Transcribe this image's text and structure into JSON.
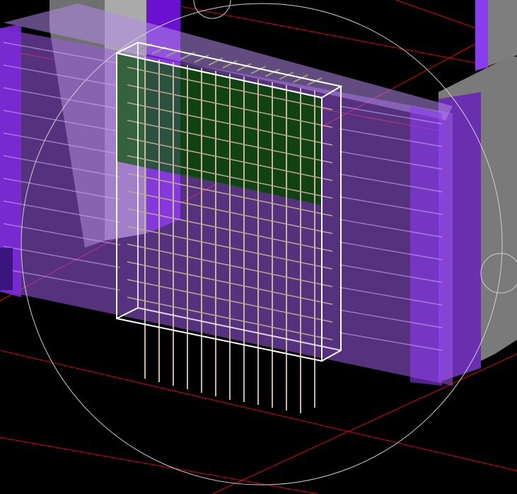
{
  "viewport": {
    "background": "#000000",
    "grid_color": "#ff0000",
    "selection_color": "#ffffff",
    "orbit_ring_color": "#c8c8c8"
  },
  "model": {
    "wall_color": "#8a3cf0",
    "column_color": "#6e2cc8",
    "side_column_color": "#7f7f7f",
    "green_zone_color": "#0a4a0a",
    "rebar_color": "#c8b4a0"
  }
}
